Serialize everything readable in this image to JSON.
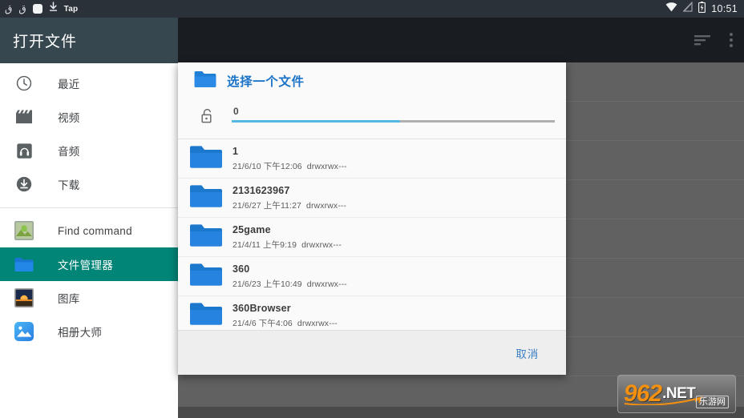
{
  "statusbar": {
    "left_glyphs": [
      "ق",
      "ق",
      "square-badge",
      "download-arrow"
    ],
    "tap_label": "Tap",
    "icons": [
      "wifi-icon",
      "signal-icon",
      "battery-charging-icon"
    ],
    "time": "10:51"
  },
  "drawer": {
    "title": "打开文件",
    "items": [
      {
        "label": "最近",
        "icon": "clock-icon",
        "selected": false
      },
      {
        "label": "视频",
        "icon": "movie-icon",
        "selected": false
      },
      {
        "label": "音频",
        "icon": "headphones-icon",
        "selected": false
      },
      {
        "label": "下载",
        "icon": "download-circle-icon",
        "selected": false
      }
    ],
    "apps": [
      {
        "label": "Find command",
        "icon": "android-app-icon",
        "selected": false
      },
      {
        "label": "文件管理器",
        "icon": "folder-app-icon",
        "selected": true
      },
      {
        "label": "图库",
        "icon": "gallery-app-icon",
        "selected": false
      },
      {
        "label": "相册大师",
        "icon": "photo-master-app-icon",
        "selected": false
      }
    ],
    "selected_color": "#008577"
  },
  "toolbar": {
    "sort_icon": "sort-icon",
    "overflow_icon": "more-vertical-icon"
  },
  "dialog": {
    "title": "选择一个文件",
    "title_color": "#1a73c7",
    "folder_icon": "folder-icon",
    "path": {
      "lock_icon": "unlock-icon",
      "value": "0",
      "progress_percent": 52,
      "fill_color": "#56b7e2",
      "track_color": "#b0b0b0"
    },
    "files": [
      {
        "name": "1",
        "date": "21/6/10 下午12:06",
        "perms": "drwxrwx---",
        "icon": "folder-icon"
      },
      {
        "name": "2131623967",
        "date": "21/6/27 上午11:27",
        "perms": "drwxrwx---",
        "icon": "folder-icon"
      },
      {
        "name": "25game",
        "date": "21/4/11 上午9:19",
        "perms": "drwxrwx---",
        "icon": "folder-icon"
      },
      {
        "name": "360",
        "date": "21/6/23 上午10:49",
        "perms": "drwxrwx---",
        "icon": "folder-icon"
      },
      {
        "name": "360Browser",
        "date": "21/4/6 下午4:06",
        "perms": "drwxrwx---",
        "icon": "folder-icon"
      }
    ],
    "cancel_label": "取消",
    "cancel_color": "#3b7fc4"
  },
  "watermark": {
    "number": "962",
    "domain": ".NET",
    "cn": "乐游网",
    "number_color": "#f39010"
  }
}
